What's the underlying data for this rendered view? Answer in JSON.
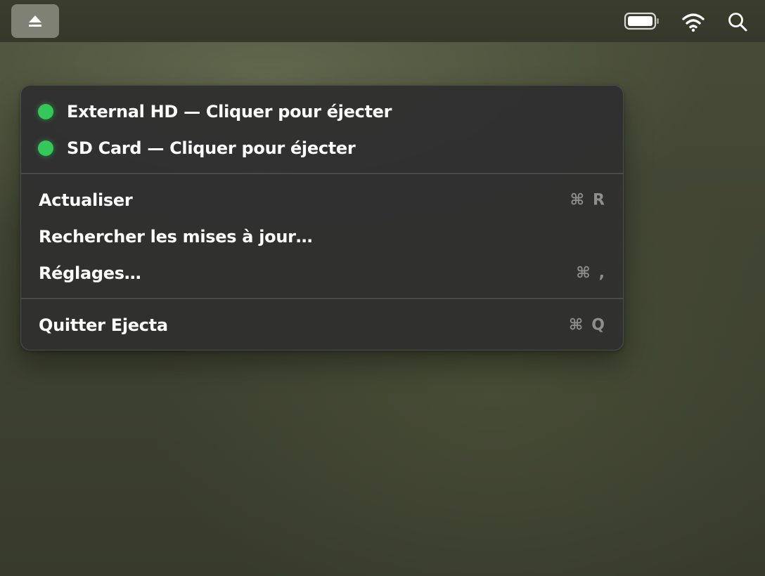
{
  "menubar": {
    "eject_icon": "eject-icon",
    "battery_icon": "battery-icon",
    "wifi_icon": "wifi-icon",
    "search_icon": "magnifying-glass-icon"
  },
  "menu": {
    "volumes": [
      {
        "label": "External HD — Cliquer pour éjecter",
        "status_color": "#34C759"
      },
      {
        "label": "SD Card — Cliquer pour éjecter",
        "status_color": "#34C759"
      }
    ],
    "actions": [
      {
        "label": "Actualiser",
        "shortcut_symbol": "⌘",
        "shortcut_key": "R"
      },
      {
        "label": "Rechercher les mises à jour…"
      },
      {
        "label": "Réglages…",
        "shortcut_symbol": "⌘",
        "shortcut_key": ","
      }
    ],
    "quit": {
      "label": "Quitter Ejecta",
      "shortcut_symbol": "⌘",
      "shortcut_key": "Q"
    }
  },
  "colors": {
    "accent_green": "#34C759",
    "menu_background": "#303030",
    "shortcut_text": "#8E8E8E"
  }
}
